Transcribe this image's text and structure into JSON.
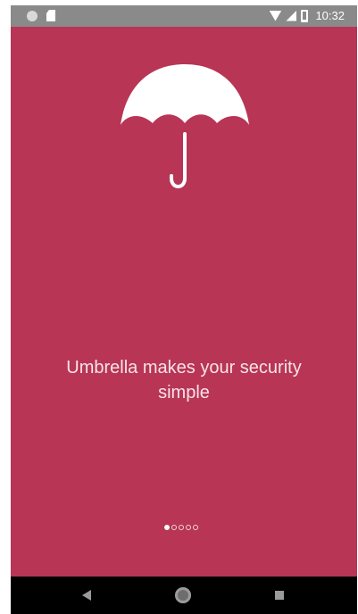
{
  "status_bar": {
    "time": "10:32",
    "left_icons": [
      "notification-dot-icon",
      "sd-card-icon"
    ],
    "right_icons": [
      "wifi-icon",
      "cell-signal-icon",
      "battery-icon"
    ]
  },
  "onboarding": {
    "illustration": "umbrella-icon",
    "tagline_line1": "Umbrella makes your security",
    "tagline_line2": "simple",
    "pager": {
      "total_pages": 5,
      "current_page": 1
    }
  },
  "nav_bar": {
    "buttons": [
      "back-icon",
      "home-icon",
      "recents-icon"
    ]
  },
  "colors": {
    "background": "#b83555",
    "status_bar": "#8a8a8a",
    "nav_bar": "#000000",
    "text": "#f7e3e9",
    "umbrella": "#ffffff"
  }
}
